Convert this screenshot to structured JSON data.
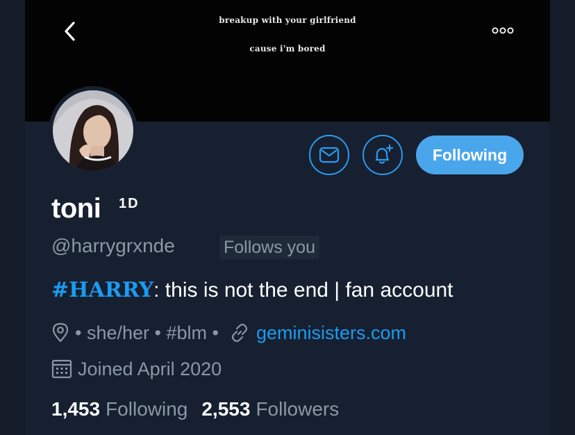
{
  "banner": {
    "line1": "breakup with your girlfriend",
    "line2": "cause i'm bored"
  },
  "nav": {
    "back_icon": "chevron-left-icon",
    "more_icon": "more-options-icon"
  },
  "profile": {
    "display_name": "toni",
    "name_badge": "1D",
    "handle": "@harrygrxnde",
    "follows_you": "Follows you",
    "bio_hashtag": "#HARRY",
    "bio_text": ": this is not the end | fan account",
    "location_icon": "location-pin-icon",
    "meta_text": "• she/her • #blm •",
    "link_icon": "link-icon",
    "website": "geminisisters.com",
    "calendar_icon": "calendar-icon",
    "joined": "Joined April 2020"
  },
  "actions": {
    "message_icon": "envelope-icon",
    "notify_icon": "bell-plus-icon",
    "following_label": "Following"
  },
  "stats": {
    "following_count": "1,453",
    "following_label": "Following",
    "followers_count": "2,553",
    "followers_label": "Followers"
  },
  "colors": {
    "accent": "#1d9bf0",
    "following_button": "#4aa6ea",
    "background": "#162030",
    "muted_text": "#8b98a5"
  }
}
